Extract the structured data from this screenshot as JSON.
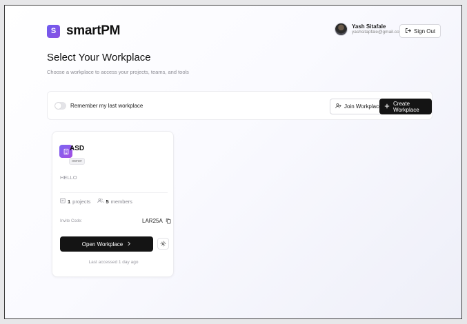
{
  "brand": {
    "logo_letter": "S",
    "name": "smartPM"
  },
  "user": {
    "name": "Yash Sitafale",
    "email": "yashsitapfale@gmail.com"
  },
  "header": {
    "signout_label": "Sign Out"
  },
  "page": {
    "title": "Select Your Workplace",
    "subtitle": "Choose a workplace to access your projects, teams, and tools"
  },
  "toolbar": {
    "remember_label": "Remember my last workplace",
    "remember_on": false,
    "join_label": "Join Workplace",
    "create_label": "Create Workplace"
  },
  "workplaces": [
    {
      "name": "ASD",
      "role": "owner",
      "description": "HELLO",
      "projects_count": "1",
      "projects_label": "projects",
      "members_count": "5",
      "members_label": "members",
      "invite_label": "Invite Code:",
      "invite_code": "LAR25A",
      "open_label": "Open Workplace",
      "last_accessed": "Last accessed 1 day ago"
    }
  ],
  "colors": {
    "accent": "#7b66f2",
    "primary_button": "#141414"
  }
}
